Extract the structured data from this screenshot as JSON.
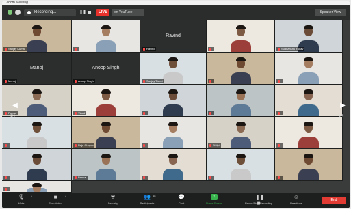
{
  "window": {
    "title": "Zoom Meeting"
  },
  "topbar": {
    "recording_label": "Recording...",
    "live_badge": "LIVE",
    "live_destination": "on YouTube",
    "speaker_view_label": "Speaker View"
  },
  "tiles": [
    {
      "name": "Sanjay Kumar",
      "video": true
    },
    {
      "name": "",
      "video": true
    },
    {
      "name": "Ravind",
      "video": false
    },
    {
      "name": "",
      "video": true
    },
    {
      "name": "Sudhanshu Yadav",
      "video": true
    },
    {
      "name": "Manoj",
      "video": false
    },
    {
      "name": "Anoop Singh",
      "video": false
    },
    {
      "name": "Sanjay Tiwari",
      "video": true
    },
    {
      "name": "",
      "video": true
    },
    {
      "name": "",
      "video": true
    },
    {
      "name": "Pawan",
      "video": true
    },
    {
      "name": "Vinod",
      "video": true
    },
    {
      "name": "",
      "video": true
    },
    {
      "name": "",
      "video": true
    },
    {
      "name": "",
      "video": true
    },
    {
      "name": "",
      "video": true
    },
    {
      "name": "Raju Chopra",
      "video": true
    },
    {
      "name": "",
      "video": true
    },
    {
      "name": "Shilpi",
      "video": true
    },
    {
      "name": "",
      "video": true
    },
    {
      "name": "",
      "video": true
    },
    {
      "name": "Pankaj",
      "video": true
    },
    {
      "name": "",
      "video": true
    },
    {
      "name": "",
      "video": true
    },
    {
      "name": "",
      "video": true
    },
    {
      "name": "",
      "video": true
    }
  ],
  "pager": {
    "left_arrow": "◀",
    "right_arrow": "▶",
    "left_page": "1/4",
    "right_page": "1/4"
  },
  "toolbar": {
    "mute": "Mute",
    "stop_video": "Stop Video",
    "security": "Security",
    "participants": "Participants",
    "participants_count": "68",
    "chat": "Chat",
    "share_screen": "Share Screen",
    "pause_recording": "Pause/Stop Recording",
    "reactions": "Reactions",
    "end": "End"
  }
}
